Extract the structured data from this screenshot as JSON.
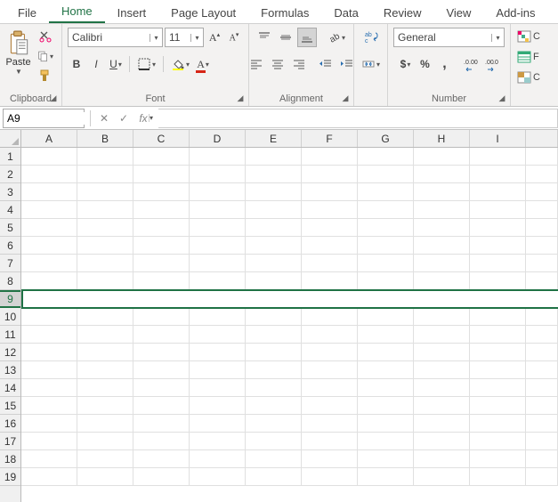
{
  "tabs": {
    "file": "File",
    "home": "Home",
    "insert": "Insert",
    "page_layout": "Page Layout",
    "formulas": "Formulas",
    "data": "Data",
    "review": "Review",
    "view": "View",
    "addins": "Add-ins"
  },
  "active_tab": "home",
  "ribbon": {
    "clipboard": {
      "label": "Clipboard",
      "paste": "Paste"
    },
    "font": {
      "label": "Font",
      "name": "Calibri",
      "size": "11",
      "bold": "B",
      "italic": "I",
      "underline": "U"
    },
    "alignment": {
      "label": "Alignment"
    },
    "number": {
      "label": "Number",
      "format": "General"
    },
    "truncated": {
      "c1": "C",
      "c2": "F",
      "c3": "C"
    }
  },
  "formula_bar": {
    "cell_ref": "A9",
    "fx": "fx",
    "formula": ""
  },
  "grid": {
    "columns": [
      "A",
      "B",
      "C",
      "D",
      "E",
      "F",
      "G",
      "H",
      "I"
    ],
    "rows": [
      "1",
      "2",
      "3",
      "4",
      "5",
      "6",
      "7",
      "8",
      "9",
      "10",
      "11",
      "12",
      "13",
      "14",
      "15",
      "16",
      "17",
      "18",
      "19"
    ],
    "selected_row_index": 8
  }
}
